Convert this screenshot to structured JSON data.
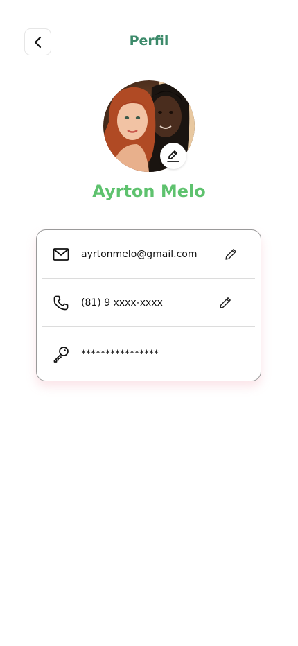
{
  "header": {
    "title": "Perfil",
    "back_icon": "chevron-left-icon"
  },
  "profile": {
    "name": "Ayrton Melo",
    "avatar_edit_icon": "pencil-underline-icon",
    "name_color": "#5ec26e",
    "title_color": "#3c8a6a"
  },
  "details": {
    "email": {
      "icon": "mail-icon",
      "value": "ayrtonmelo@gmail.com",
      "edit_icon": "pencil-icon"
    },
    "phone": {
      "icon": "phone-icon",
      "value": "(81) 9 xxxx-xxxx",
      "edit_icon": "pencil-icon"
    },
    "password": {
      "icon": "key-icon",
      "value": "****************"
    }
  }
}
